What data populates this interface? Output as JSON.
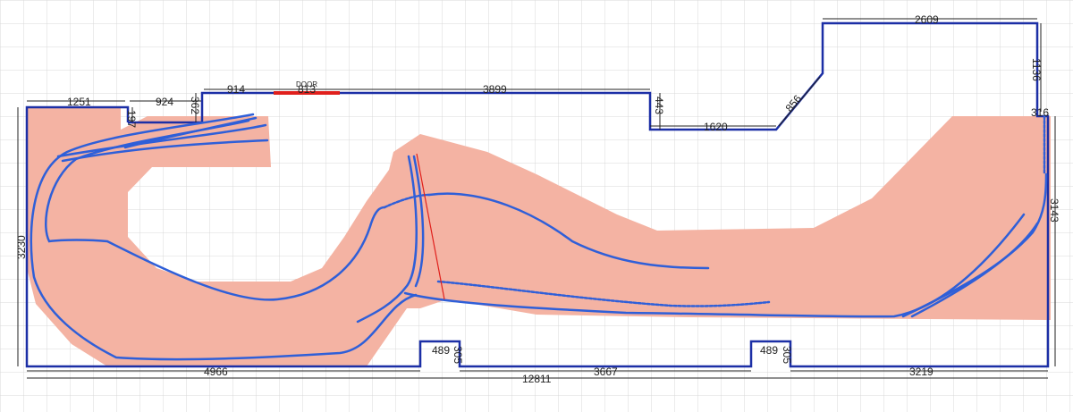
{
  "plan": {
    "door_label": "DOOR",
    "dimensions": {
      "top_left_width": "1251",
      "notch_a_width": "924",
      "notch_a_depth": "197",
      "step_height": "362",
      "segment_914": "914",
      "door_width": "813",
      "top_long": "3899",
      "recess_depth": "443",
      "recess_width": "1620",
      "diagonal": "856",
      "tower_width": "2609",
      "tower_height": "1136",
      "right_offset": "316",
      "right_height": "3143",
      "left_height": "3230",
      "bottom_left": "4966",
      "post_a_width": "489",
      "post_a_depth": "305",
      "bottom_mid": "3667",
      "post_b_width": "489",
      "post_b_depth": "305",
      "bottom_right": "3219",
      "overall_width": "12811"
    }
  },
  "colors": {
    "wall": "#1c2fa6",
    "door": "#e0201c",
    "baseboard": "#f4b3a3",
    "track": "#2f5fd8",
    "dim": "#222222",
    "grid": "#d9d9d9",
    "cut_line": "#e0201c"
  }
}
